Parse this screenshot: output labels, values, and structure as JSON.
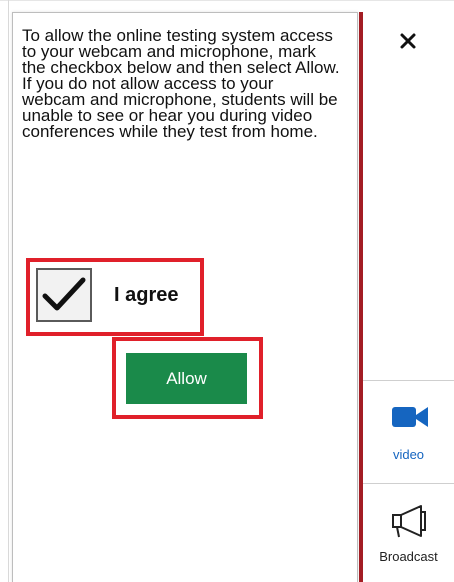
{
  "popup": {
    "message": "To allow the online testing system access to your webcam and microphone, mark the checkbox below and then select Allow. If you do not allow access to your webcam and microphone, students will be unable to see or hear you during video conferences while they test from home.",
    "agree_label": "I agree",
    "agree_checked": true,
    "allow_label": "Allow"
  },
  "sidebar": {
    "close_icon": "close-icon",
    "items": [
      {
        "label": "video",
        "icon": "video-camera-icon",
        "color": "#1565c0"
      },
      {
        "label": "Broadcast",
        "icon": "megaphone-icon",
        "color": "#222222"
      }
    ]
  },
  "colors": {
    "accent_red": "#a31d24",
    "highlight_red": "#e0202a",
    "allow_green": "#1a8a4a",
    "video_blue": "#1565c0"
  }
}
